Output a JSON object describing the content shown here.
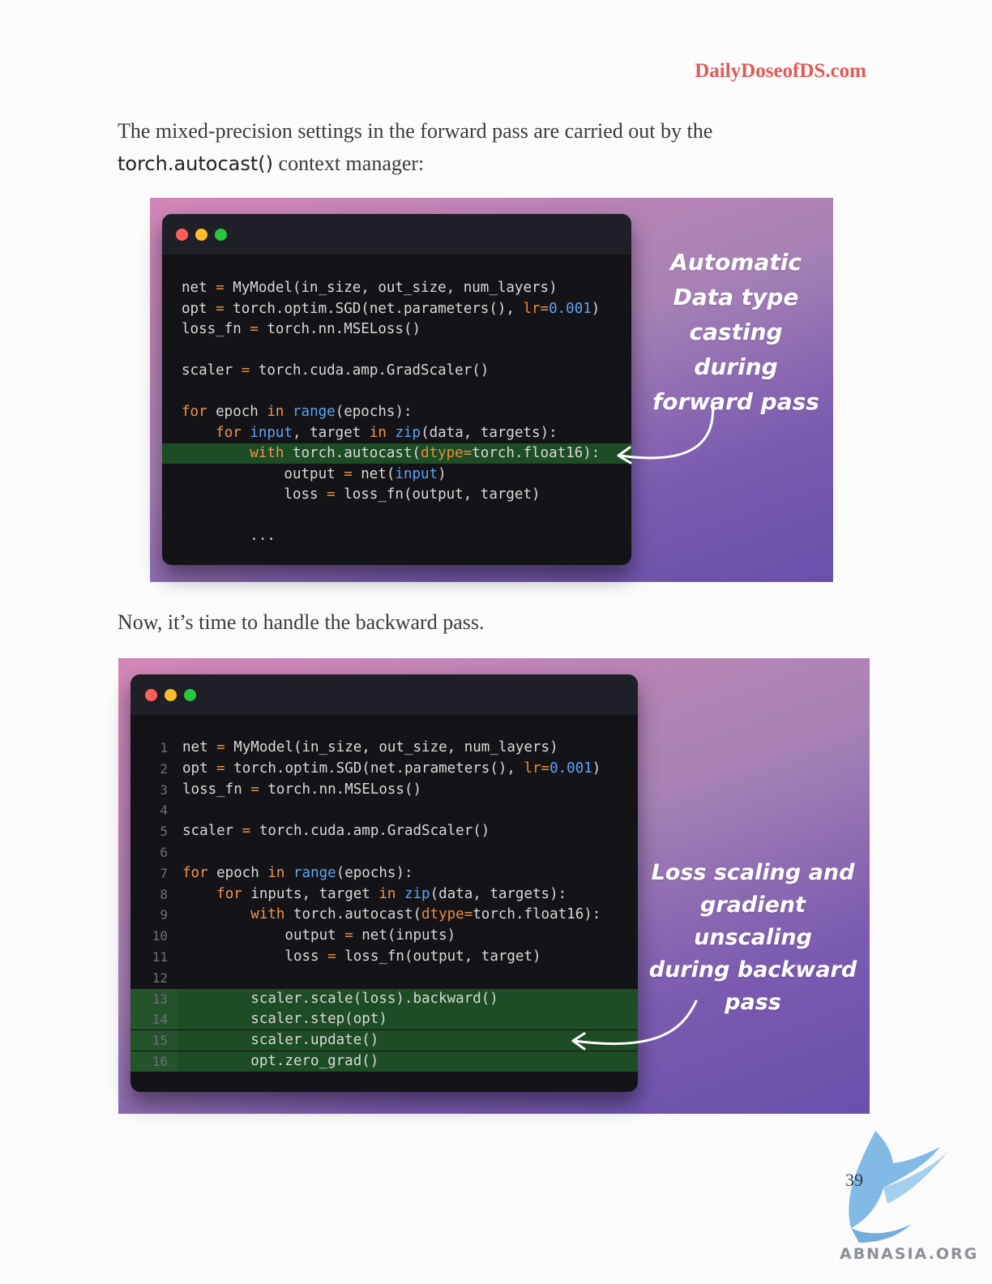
{
  "header": {
    "site": "DailyDoseofDS.com"
  },
  "intro": {
    "before": "The mixed-precision settings in the forward pass are carried out by the",
    "code": "torch.autocast()",
    "after": " context manager:"
  },
  "panel1": {
    "callout": [
      "Automatic",
      "Data type",
      "casting during",
      "forward pass"
    ],
    "lines": [
      "net = MyModel(in_size, out_size, num_layers)",
      "opt = torch.optim.SGD(net.parameters(), lr=0.001)",
      "loss_fn = torch.nn.MSELoss()",
      "",
      "scaler = torch.cuda.amp.GradScaler()",
      "",
      "for epoch in range(epochs):",
      "    for input, target in zip(data, targets):",
      "        with torch.autocast(dtype=torch.float16):",
      "            output = net(input)",
      "            loss = loss_fn(output, target)",
      "",
      "        ..."
    ]
  },
  "middle": {
    "text": "Now, it’s time to handle the backward pass."
  },
  "panel2": {
    "callout": [
      "Loss scaling and",
      "gradient unscaling",
      "during backward",
      "pass"
    ],
    "lines": [
      {
        "n": "1",
        "t": "net = MyModel(in_size, out_size, num_layers)"
      },
      {
        "n": "2",
        "t": "opt = torch.optim.SGD(net.parameters(), lr=0.001)"
      },
      {
        "n": "3",
        "t": "loss_fn = torch.nn.MSELoss()"
      },
      {
        "n": "4",
        "t": ""
      },
      {
        "n": "5",
        "t": "scaler = torch.cuda.amp.GradScaler()"
      },
      {
        "n": "6",
        "t": ""
      },
      {
        "n": "7",
        "t": "for epoch in range(epochs):"
      },
      {
        "n": "8",
        "t": "    for inputs, target in zip(data, targets):"
      },
      {
        "n": "9",
        "t": "        with torch.autocast(dtype=torch.float16):"
      },
      {
        "n": "10",
        "t": "            output = net(inputs)"
      },
      {
        "n": "11",
        "t": "            loss = loss_fn(output, target)"
      },
      {
        "n": "12",
        "t": ""
      },
      {
        "n": "13",
        "t": "        scaler.scale(loss).backward()"
      },
      {
        "n": "14",
        "t": "        scaler.step(opt)"
      },
      {
        "n": "15",
        "t": "        scaler.update()"
      },
      {
        "n": "16",
        "t": "        opt.zero_grad()"
      }
    ]
  },
  "footer": {
    "page_number": "39",
    "watermark": "ABNASIA.ORG"
  }
}
